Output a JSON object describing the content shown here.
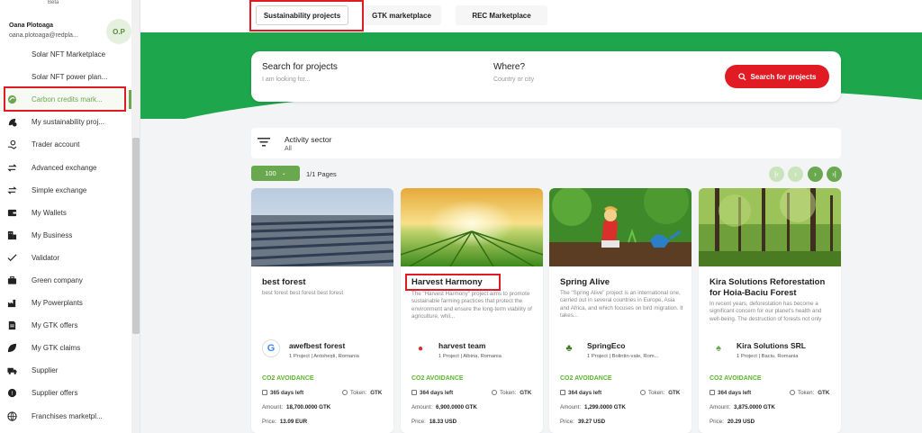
{
  "sidebar": {
    "beta": "Beta",
    "user_name": "Oana Plotoaga",
    "user_email": "oana.plotoaga@redpla...",
    "avatar_initials": "O.P",
    "items": [
      {
        "label": "Solar NFT Marketplace",
        "icon": ""
      },
      {
        "label": "Solar NFT power plan...",
        "icon": ""
      },
      {
        "label": "Carbon credits mark...",
        "icon": "globe-leaf-icon",
        "active": true
      },
      {
        "label": "My sustainability proj...",
        "icon": "leaf-gear-icon"
      },
      {
        "label": "Trader account",
        "icon": "hand-coin-icon"
      },
      {
        "label": "Advanced exchange",
        "icon": "exchange-icon"
      },
      {
        "label": "Simple exchange",
        "icon": "exchange-icon"
      },
      {
        "label": "My Wallets",
        "icon": "wallet-icon"
      },
      {
        "label": "My Business",
        "icon": "building-icon"
      },
      {
        "label": "Validator",
        "icon": "check-icon"
      },
      {
        "label": "Green company",
        "icon": "briefcase-icon"
      },
      {
        "label": "My Powerplants",
        "icon": "factory-icon"
      },
      {
        "label": "My GTK offers",
        "icon": "document-icon"
      },
      {
        "label": "My GTK claims",
        "icon": "leaf-icon"
      },
      {
        "label": "Supplier",
        "icon": "truck-icon"
      },
      {
        "label": "Supplier offers",
        "icon": "badge-icon"
      },
      {
        "label": "Franchises marketpl...",
        "icon": "globe-icon"
      }
    ]
  },
  "tabs": [
    {
      "label": "Sustainability projects",
      "active": true
    },
    {
      "label": "GTK marketplace"
    },
    {
      "label": "REC Marketplace"
    }
  ],
  "search": {
    "label": "Search for projects",
    "placeholder": "I am looking for...",
    "where_label": "Where?",
    "where_placeholder": "Country or city",
    "button": "Search for projects"
  },
  "filter": {
    "title": "Activity sector",
    "value": "All"
  },
  "pagination": {
    "per_page": "100",
    "pages": "1/1 Pages",
    "buttons": [
      "|‹",
      "‹",
      "›",
      "›|"
    ]
  },
  "cards": [
    {
      "title": "best forest",
      "description": "best forest best forest best forest",
      "org_name": "awefbest forest",
      "org_meta": "1 Project | Antohești, Romania",
      "org_logo": "G",
      "co2": "CO2 AVOIDANCE",
      "days": "365 days left",
      "token_label": "Token:",
      "token": "GTK",
      "amount_label": "Amount:",
      "amount": "18,700.0000 GTK",
      "price_label": "Price:",
      "price": "13.09 EUR"
    },
    {
      "title": "Harvest Harmony",
      "description": "The \"Harvest Harmony\" project aims to promote sustainable farming practices that protect the environment and ensure the long-term viability of agriculture, whil...",
      "org_name": "harvest team",
      "org_meta": "1 Project | Albina, Romania",
      "org_logo": "●",
      "co2": "CO2 AVOIDANCE",
      "days": "364 days left",
      "token_label": "Token:",
      "token": "GTK",
      "amount_label": "Amount:",
      "amount": "6,900.0000 GTK",
      "price_label": "Price:",
      "price": "18.33 USD"
    },
    {
      "title": "Spring Alive",
      "description": "The \"Spring Alive\" project is an international one, carried out in several countries in Europe, Asia and Africa, and which focuses on bird migration. It takes...",
      "org_name": "SpringEco",
      "org_meta": "1 Project | Bolintin-vale, Rom...",
      "org_logo": "♣",
      "co2": "CO2 AVOIDANCE",
      "days": "364 days left",
      "token_label": "Token:",
      "token": "GTK",
      "amount_label": "Amount:",
      "amount": "1,299.0000 GTK",
      "price_label": "Price:",
      "price": "39.27 USD"
    },
    {
      "title": "Kira Solutions Reforestation for Hoia-Baciu Forest",
      "description": "In recent years, deforestation has become a significant concern for our planet's health and well-being. The destruction of forests not only leads to th...",
      "org_name": "Kira Solutions SRL",
      "org_meta": "1 Project | Baciu, Romania",
      "org_logo": "♠",
      "co2": "CO2 AVOIDANCE",
      "days": "364 days left",
      "token_label": "Token:",
      "token": "GTK",
      "amount_label": "Amount:",
      "amount": "3,875.0000 GTK",
      "price_label": "Price:",
      "price": "20.29 USD"
    }
  ],
  "colors": {
    "brand_green": "#6aa84f",
    "banner_green": "#1da64b",
    "accent_red": "#e01b24"
  }
}
